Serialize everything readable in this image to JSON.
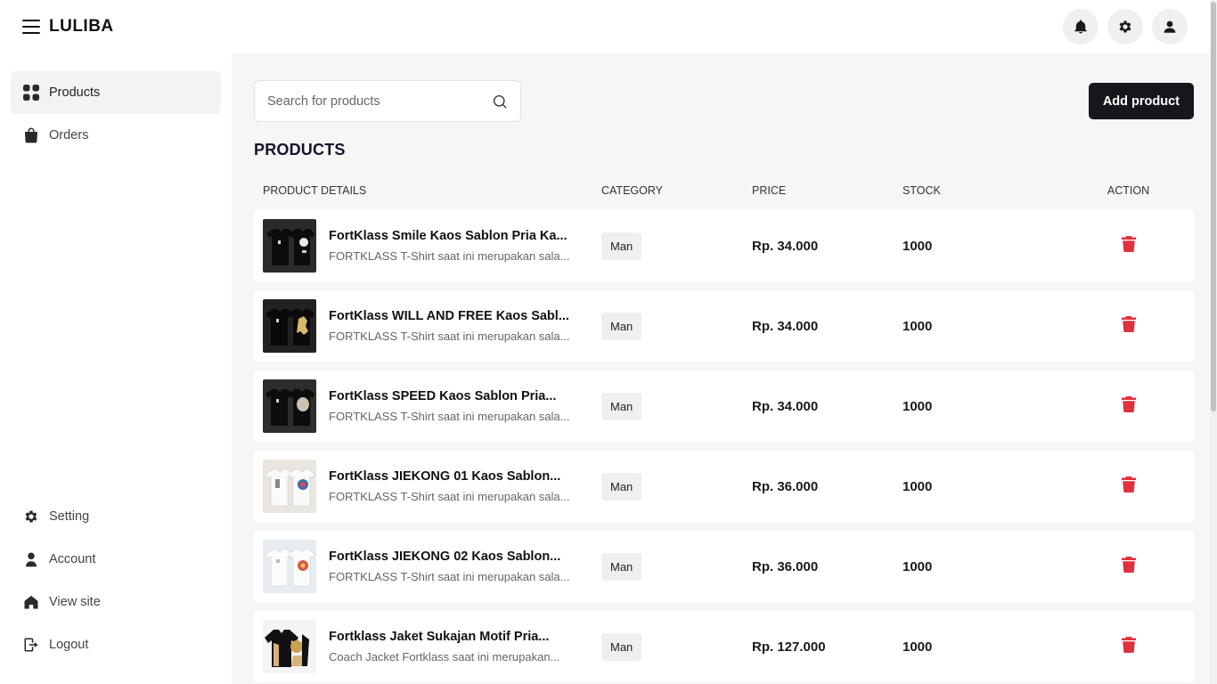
{
  "header": {
    "brand": "LULIBA"
  },
  "sidebar": {
    "items": [
      {
        "label": "Products"
      },
      {
        "label": "Orders"
      }
    ],
    "bottom": [
      {
        "label": "Setting"
      },
      {
        "label": "Account"
      },
      {
        "label": "View site"
      },
      {
        "label": "Logout"
      }
    ]
  },
  "main": {
    "search_placeholder": "Search for products",
    "add_label": "Add product",
    "title": "PRODUCTS",
    "columns": [
      "PRODUCT DETAILS",
      "CATEGORY",
      "PRICE",
      "STOCK",
      "ACTION"
    ],
    "products": [
      {
        "name": "FortKlass Smile Kaos Sablon Pria Ka...",
        "desc": "FORTKLASS T-Shirt saat ini merupakan sala...",
        "category": "Man",
        "price": "Rp. 34.000",
        "stock": "1000"
      },
      {
        "name": "FortKlass WILL AND FREE Kaos Sabl...",
        "desc": "FORTKLASS T-Shirt saat ini merupakan sala...",
        "category": "Man",
        "price": "Rp. 34.000",
        "stock": "1000"
      },
      {
        "name": "FortKlass SPEED Kaos Sablon Pria...",
        "desc": "FORTKLASS T-Shirt saat ini merupakan sala...",
        "category": "Man",
        "price": "Rp. 34.000",
        "stock": "1000"
      },
      {
        "name": "FortKlass JIEKONG 01 Kaos Sablon...",
        "desc": "FORTKLASS T-Shirt saat ini merupakan sala...",
        "category": "Man",
        "price": "Rp. 36.000",
        "stock": "1000"
      },
      {
        "name": "FortKlass JIEKONG 02 Kaos Sablon...",
        "desc": "FORTKLASS T-Shirt saat ini merupakan sala...",
        "category": "Man",
        "price": "Rp. 36.000",
        "stock": "1000"
      },
      {
        "name": "Fortklass Jaket Sukajan Motif Pria...",
        "desc": "Coach Jacket Fortklass saat ini merupakan...",
        "category": "Man",
        "price": "Rp. 127.000",
        "stock": "1000"
      }
    ]
  }
}
